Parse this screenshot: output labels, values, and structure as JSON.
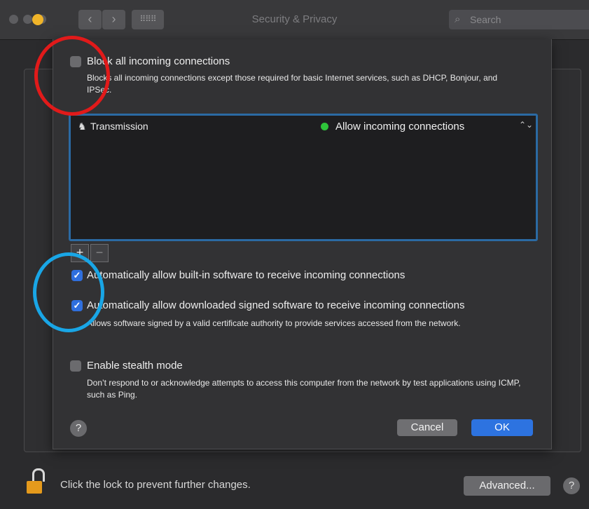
{
  "window": {
    "title": "Security & Privacy",
    "search_placeholder": "Search"
  },
  "toolbar": {
    "back_icon": "chevron-left-icon",
    "forward_icon": "chevron-right-icon",
    "show_all_icon": "grid-icon"
  },
  "sheet": {
    "block_all": {
      "label": "Block all incoming connections",
      "description": "Blocks all incoming connections except those required for basic Internet services, such as DHCP, Bonjour, and IPSec.",
      "checked": false
    },
    "apps": [
      {
        "name": "Transmission",
        "status": "Allow incoming connections",
        "status_color": "#2ec43a"
      }
    ],
    "add_label": "+",
    "remove_label": "−",
    "auto_builtin": {
      "label": "Automatically allow built-in software to receive incoming connections",
      "checked": true
    },
    "auto_signed": {
      "label": "Automatically allow downloaded signed software to receive incoming connections",
      "description": "Allows software signed by a valid certificate authority to provide services accessed from the network.",
      "checked": true
    },
    "stealth": {
      "label": "Enable stealth mode",
      "description": "Don’t respond to or acknowledge attempts to access this computer from the network by test applications using ICMP, such as Ping.",
      "checked": false
    },
    "help_label": "?",
    "cancel_label": "Cancel",
    "ok_label": "OK"
  },
  "footer": {
    "lock_text": "Click the lock to prevent further changes.",
    "advanced_label": "Advanced...",
    "help_label": "?"
  },
  "colors": {
    "accent": "#2d73e0",
    "annotation_red": "#e11a1a",
    "annotation_blue": "#19a6e6"
  }
}
